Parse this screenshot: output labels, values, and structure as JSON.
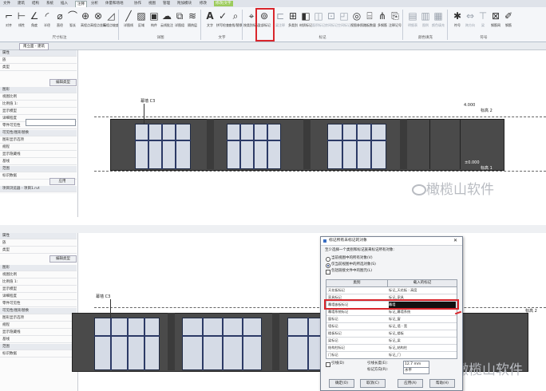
{
  "ribbon": {
    "tabs": [
      "文件",
      "建筑",
      "结构",
      "系统",
      "插入",
      "注释",
      "分析",
      "体量和场地",
      "协作",
      "视图",
      "管理",
      "附加模块",
      "修改",
      "修改|文字"
    ],
    "buttons": [
      {
        "label": "对齐",
        "icon": "align-icon"
      },
      {
        "label": "线性",
        "icon": "linear-dim-icon"
      },
      {
        "label": "角度",
        "icon": "angle-icon"
      },
      {
        "label": "半径",
        "icon": "radius-icon"
      },
      {
        "label": "直径",
        "icon": "diameter-icon"
      },
      {
        "label": "弧长",
        "icon": "arc-length-icon"
      },
      {
        "label": "高程点",
        "icon": "spot-elevation-icon"
      },
      {
        "label": "高程点坐标",
        "icon": "spot-coordinate-icon"
      },
      {
        "label": "高程点坡度",
        "icon": "spot-slope-icon"
      },
      {
        "label": "详图线",
        "icon": "detail-line-icon"
      },
      {
        "label": "区域",
        "icon": "region-icon"
      },
      {
        "label": "构件",
        "icon": "component-icon"
      },
      {
        "label": "云线批注",
        "icon": "revision-cloud-icon"
      },
      {
        "label": "详图组",
        "icon": "detail-group-icon"
      },
      {
        "label": "隔热层",
        "icon": "insulation-icon"
      },
      {
        "label": "文字",
        "icon": "text-icon"
      },
      {
        "label": "拼写检查",
        "icon": "spell-check-icon"
      },
      {
        "label": "查找/替换",
        "icon": "find-replace-icon"
      },
      {
        "label": "按类别标记",
        "icon": "tag-by-category-icon"
      },
      {
        "label": "全部标记",
        "icon": "tag-all-icon"
      },
      {
        "label": "梁注释",
        "icon": "beam-annotation-icon"
      },
      {
        "label": "多类别",
        "icon": "multi-category-icon"
      },
      {
        "label": "材质标记",
        "icon": "material-tag-icon"
      },
      {
        "label": "面积标记",
        "icon": "area-tag-icon"
      },
      {
        "label": "房间标记",
        "icon": "room-tag-icon"
      },
      {
        "label": "空间标记",
        "icon": "space-tag-icon"
      },
      {
        "label": "视图参照",
        "icon": "view-reference-icon"
      },
      {
        "label": "踏板数量",
        "icon": "tread-number-icon"
      },
      {
        "label": "多钢筋",
        "icon": "multi-rebar-icon"
      },
      {
        "label": "注释记号",
        "icon": "keynote-icon"
      },
      {
        "label": "明细表",
        "icon": "schedule-icon"
      },
      {
        "label": "图例",
        "icon": "legend-icon"
      },
      {
        "label": "颜色填充",
        "icon": "color-fill-icon"
      },
      {
        "label": "符号",
        "icon": "symbol-icon"
      },
      {
        "label": "跨方向",
        "icon": "span-direction-icon"
      },
      {
        "label": "梁",
        "icon": "beam-symbol-icon"
      },
      {
        "label": "钢筋网",
        "icon": "fabric-icon"
      },
      {
        "label": "钢筋",
        "icon": "rebar-symbol-icon"
      }
    ],
    "groups": [
      "尺寸标注",
      "详图",
      "文字",
      "标记",
      "颜色填充",
      "符号"
    ],
    "highlighted_label": "全部标记"
  },
  "view_tab": "南立面 - 建筑",
  "left_panel": {
    "rows": [
      "属性",
      "族",
      "类型",
      "编辑类型",
      "图形",
      "视图比例",
      "比例值 1:",
      "显示模型",
      "详细程度",
      "零件可见性",
      "可见性/图形替换",
      "图形显示选项",
      "规程",
      "显示隐藏线",
      "基线",
      "范围",
      "标识数据",
      "应用"
    ],
    "browser_title": "项目浏览器 - 项目1.rvt"
  },
  "view1": {
    "tag_label": "幕墙 C3",
    "level_top_value": "4.000",
    "level_top_name": "标高 2",
    "level_bottom_value": "±0.000",
    "level_bottom_name": "标高 1"
  },
  "view2": {
    "tag_label": "幕墙 C3",
    "level_name": "标高 2"
  },
  "dialog": {
    "title": "标记所有未标记的对象",
    "prompt": "至少选择一个类别和标记族来标记所有对象:",
    "options": [
      {
        "label": "当前视图中的所有对象(V)",
        "checked": false
      },
      {
        "label": "仅当前视图中的所选对象(S)",
        "checked": true
      }
    ],
    "include_linked": "包括链接文件中的图元(L)",
    "columns": [
      "类别",
      "载入的标记"
    ],
    "rows": [
      {
        "category": "天花板标记",
        "tag": "标记_天花板 : 高度",
        "selected": false
      },
      {
        "category": "家具标记",
        "tag": "标记_家具",
        "selected": false
      },
      {
        "category": "幕墙嵌板标记",
        "tag": "幕墙",
        "selected": true
      },
      {
        "category": "幕墙系统标记",
        "tag": "标记_幕墙系统",
        "selected": false
      },
      {
        "category": "窗标记",
        "tag": "标记_窗",
        "selected": false
      },
      {
        "category": "墙标记",
        "tag": "标记_墙 - 宽",
        "selected": false
      },
      {
        "category": "楼板标记",
        "tag": "标记_楼板",
        "selected": false
      },
      {
        "category": "梁标记",
        "tag": "标记_梁",
        "selected": false
      },
      {
        "category": "结构柱标记",
        "tag": "标记_结构柱",
        "selected": false
      },
      {
        "category": "门标记",
        "tag": "标记_门",
        "selected": false
      }
    ],
    "leader_label": "引线(D)",
    "leader_length_label": "引线长度(E):",
    "leader_length_value": "12.7 mm",
    "orientation_label": "标记方向(R):",
    "orientation_value": "水平",
    "buttons": [
      "确定(O)",
      "取消(C)",
      "应用(A)",
      "帮助(H)"
    ]
  },
  "watermark": "橄榄山软件"
}
